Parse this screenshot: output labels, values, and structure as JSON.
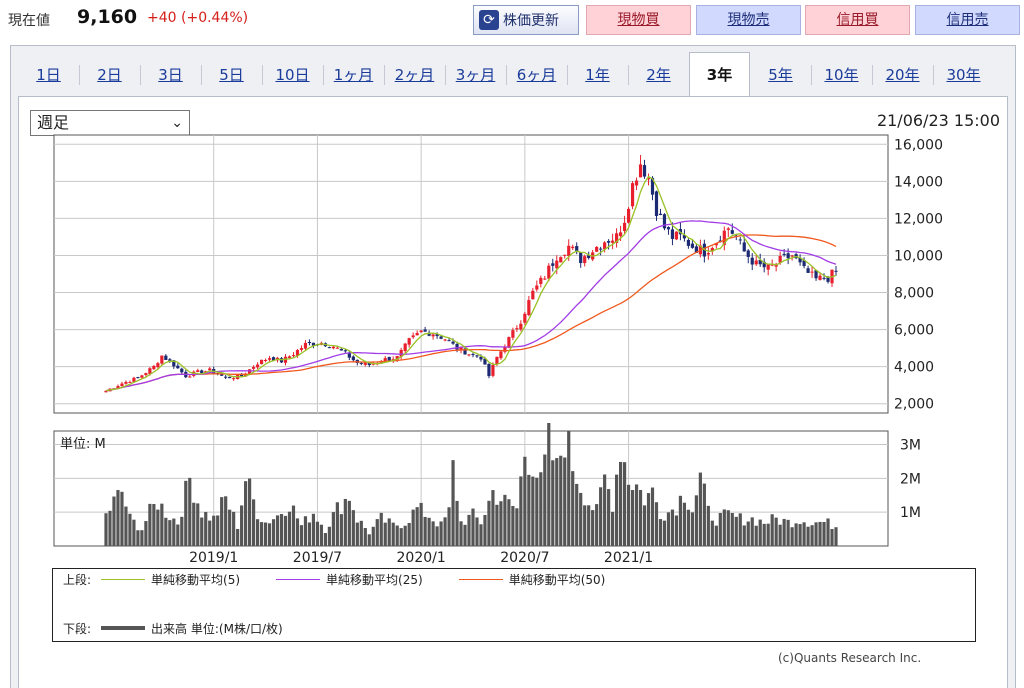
{
  "header": {
    "price_label": "現在値",
    "price": "9,160",
    "change": "+40 (+0.44%)",
    "refresh_label": "株価更新",
    "buttons": [
      "現物買",
      "現物売",
      "信用買",
      "信用売"
    ]
  },
  "tabs": [
    "1日",
    "2日",
    "3日",
    "5日",
    "10日",
    "1ヶ月",
    "2ヶ月",
    "3ヶ月",
    "6ヶ月",
    "1年",
    "2年",
    "3年",
    "5年",
    "10年",
    "20年",
    "30年"
  ],
  "active_tab": "3年",
  "period_select": "週足",
  "timestamp": "21/06/23 15:00",
  "legend": {
    "upper_label": "上段:",
    "lower_label": "下段:",
    "ma5": "単純移動平均(5)",
    "ma25": "単純移動平均(25)",
    "ma50": "単純移動平均(50)",
    "volume": "出来高 単位:(M株/口/枚)"
  },
  "credit": "(c)Quants Research Inc.",
  "colors": {
    "up": "#e8202e",
    "down": "#1b2a72",
    "ma5": "#9ac226",
    "ma25": "#a23ce6",
    "ma50": "#f0581e",
    "volume": "#555555"
  },
  "chart_data": {
    "type": "candlestick",
    "price_axis": {
      "ylim": [
        1500,
        16500
      ],
      "ticks": [
        "2,000",
        "4,000",
        "6,000",
        "8,000",
        "10,000",
        "12,000",
        "14,000",
        "16,000"
      ]
    },
    "volume_axis": {
      "unit_label": "単位: M",
      "ylim": [
        0,
        3.4
      ],
      "ticks": [
        "1M",
        "2M",
        "3M"
      ]
    },
    "x_ticks": [
      "2019/1",
      "2019/7",
      "2020/1",
      "2020/7",
      "2021/1"
    ],
    "price_anchors": [
      [
        0,
        2700
      ],
      [
        4,
        3100
      ],
      [
        8,
        3400
      ],
      [
        12,
        4000
      ],
      [
        14,
        4600
      ],
      [
        17,
        4100
      ],
      [
        20,
        3500
      ],
      [
        23,
        3700
      ],
      [
        26,
        3800
      ],
      [
        30,
        3400
      ],
      [
        34,
        3500
      ],
      [
        38,
        4200
      ],
      [
        41,
        4500
      ],
      [
        44,
        4300
      ],
      [
        47,
        4700
      ],
      [
        50,
        5200
      ],
      [
        54,
        5300
      ],
      [
        57,
        5100
      ],
      [
        60,
        4700
      ],
      [
        63,
        4200
      ],
      [
        66,
        4100
      ],
      [
        70,
        4400
      ],
      [
        73,
        4500
      ],
      [
        76,
        5400
      ],
      [
        79,
        5900
      ],
      [
        82,
        5800
      ],
      [
        85,
        5500
      ],
      [
        88,
        5000
      ],
      [
        91,
        4700
      ],
      [
        94,
        4500
      ],
      [
        96,
        3500
      ],
      [
        98,
        4500
      ],
      [
        101,
        5500
      ],
      [
        104,
        6500
      ],
      [
        107,
        8000
      ],
      [
        110,
        8900
      ],
      [
        113,
        10000
      ],
      [
        116,
        10500
      ],
      [
        119,
        9800
      ],
      [
        122,
        10300
      ],
      [
        125,
        10800
      ],
      [
        128,
        11000
      ],
      [
        130,
        12000
      ],
      [
        132,
        13800
      ],
      [
        134,
        15000
      ],
      [
        136,
        14200
      ],
      [
        138,
        12500
      ],
      [
        140,
        11500
      ],
      [
        142,
        11000
      ],
      [
        144,
        11000
      ],
      [
        147,
        10500
      ],
      [
        150,
        10200
      ],
      [
        153,
        10800
      ],
      [
        156,
        11500
      ],
      [
        158,
        11000
      ],
      [
        160,
        10200
      ],
      [
        163,
        9500
      ],
      [
        166,
        9300
      ],
      [
        169,
        9700
      ],
      [
        172,
        10000
      ],
      [
        175,
        9200
      ],
      [
        178,
        8700
      ],
      [
        181,
        8800
      ],
      [
        183,
        9160
      ]
    ],
    "volume_anchors": [
      [
        0,
        0.9
      ],
      [
        2,
        1.3
      ],
      [
        4,
        1.6
      ],
      [
        6,
        0.8
      ],
      [
        9,
        0.5
      ],
      [
        11,
        1.0
      ],
      [
        13,
        1.3
      ],
      [
        15,
        1.0
      ],
      [
        18,
        0.7
      ],
      [
        21,
        2.0
      ],
      [
        24,
        1.0
      ],
      [
        27,
        0.8
      ],
      [
        30,
        1.4
      ],
      [
        33,
        0.6
      ],
      [
        35,
        2.0
      ],
      [
        38,
        1.0
      ],
      [
        40,
        0.7
      ],
      [
        43,
        0.9
      ],
      [
        46,
        1.3
      ],
      [
        49,
        0.6
      ],
      [
        52,
        1.0
      ],
      [
        55,
        0.5
      ],
      [
        58,
        1.1
      ],
      [
        61,
        1.5
      ],
      [
        63,
        0.8
      ],
      [
        66,
        0.4
      ],
      [
        69,
        0.8
      ],
      [
        72,
        0.6
      ],
      [
        75,
        0.7
      ],
      [
        78,
        1.1
      ],
      [
        81,
        0.9
      ],
      [
        84,
        0.6
      ],
      [
        86,
        1.0
      ],
      [
        87,
        2.3
      ],
      [
        89,
        0.7
      ],
      [
        92,
        0.9
      ],
      [
        94,
        0.7
      ],
      [
        97,
        1.6
      ],
      [
        100,
        1.3
      ],
      [
        103,
        1.1
      ],
      [
        105,
        2.8
      ],
      [
        107,
        2.5
      ],
      [
        109,
        1.8
      ],
      [
        111,
        3.0
      ],
      [
        113,
        2.2
      ],
      [
        115,
        3.3
      ],
      [
        117,
        2.4
      ],
      [
        119,
        1.8
      ],
      [
        121,
        1.3
      ],
      [
        123,
        1.0
      ],
      [
        125,
        2.0
      ],
      [
        127,
        1.3
      ],
      [
        129,
        3.0
      ],
      [
        131,
        2.0
      ],
      [
        133,
        1.8
      ],
      [
        135,
        1.4
      ],
      [
        137,
        1.6
      ],
      [
        139,
        1.0
      ],
      [
        141,
        1.0
      ],
      [
        143,
        1.2
      ],
      [
        145,
        1.6
      ],
      [
        147,
        1.1
      ],
      [
        149,
        2.0
      ],
      [
        151,
        1.0
      ],
      [
        153,
        0.8
      ],
      [
        156,
        0.9
      ],
      [
        159,
        0.8
      ],
      [
        162,
        0.8
      ],
      [
        165,
        0.7
      ],
      [
        168,
        0.8
      ],
      [
        171,
        0.7
      ],
      [
        174,
        0.8
      ],
      [
        177,
        0.7
      ],
      [
        180,
        0.7
      ],
      [
        183,
        0.6
      ]
    ],
    "weeks": 184,
    "x_tick_weeks": [
      27,
      53,
      79,
      105,
      131
    ],
    "series": [
      "単純移動平均(5)",
      "単純移動平均(25)",
      "単純移動平均(50)",
      "出来高"
    ]
  }
}
